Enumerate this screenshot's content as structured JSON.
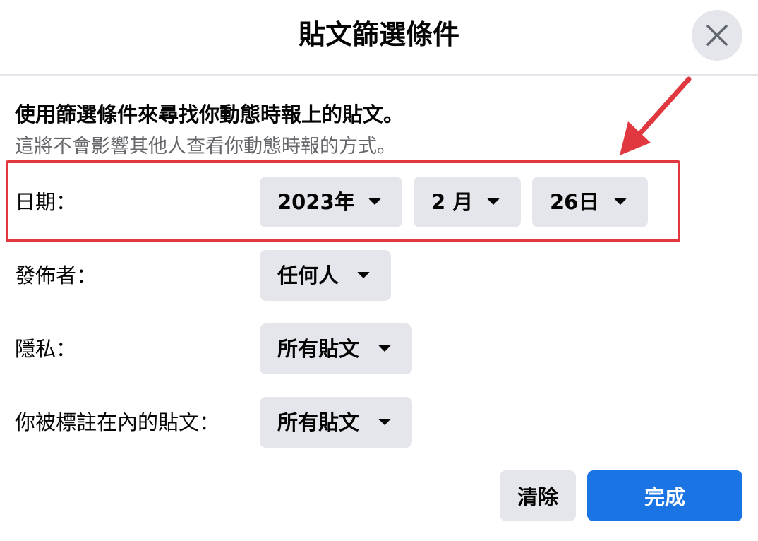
{
  "dialog": {
    "title": "貼文篩選條件",
    "close_icon": "close-icon"
  },
  "intro": {
    "title": "使用篩選條件來尋找你動態時報上的貼文。",
    "subtitle": "這將不會影響其他人查看你動態時報的方式。"
  },
  "filters": {
    "date": {
      "label": "日期：",
      "year": "2023年",
      "month": "2 月",
      "day": "26日"
    },
    "poster": {
      "label": "發佈者：",
      "value": "任何人"
    },
    "privacy": {
      "label": "隱私：",
      "value": "所有貼文"
    },
    "tagged": {
      "label": "你被標註在內的貼文：",
      "value": "所有貼文"
    }
  },
  "actions": {
    "clear_label": "清除",
    "done_label": "完成"
  },
  "colors": {
    "accent": "#1b74e4",
    "highlight": "#e0383e",
    "button_gray": "#e4e6eb",
    "secondary_text": "#65676b"
  },
  "icons": {
    "dropdown": "caret-down-icon",
    "annotation": "red-arrow-annotation"
  }
}
